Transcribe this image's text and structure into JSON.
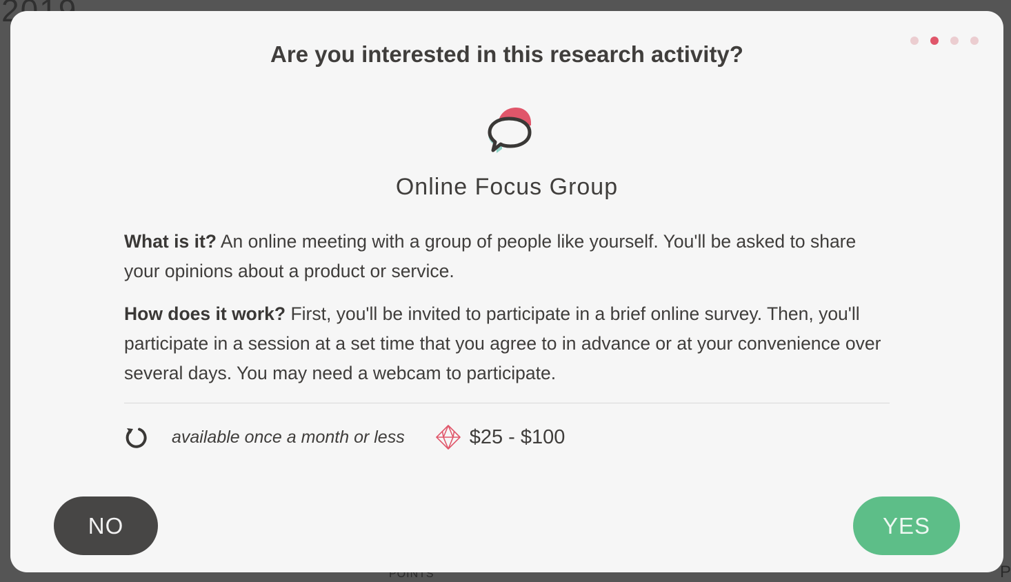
{
  "background": {
    "year_fragment": "2019",
    "points_label": "POINTS",
    "edge_letter": "P"
  },
  "modal": {
    "title": "Are you interested in this research activity?",
    "progress": {
      "total_steps": 4,
      "current_step": 2
    },
    "activity": {
      "icon": "chat-bubble-icon",
      "name": "Online Focus Group"
    },
    "description": {
      "what_label": "What is it?",
      "what_text": " An online meeting with a group of people like yourself. You'll be asked to share your opinions about a product or service.",
      "how_label": "How does it work?",
      "how_text": " First, you'll be invited to participate in a brief online survey. Then, you'll participate in a session at a set time that you agree to in advance or at your convenience over several days. You may need a webcam to participate."
    },
    "meta": {
      "frequency_icon": "refresh-icon",
      "frequency": "available once a month or less",
      "reward_icon": "gem-icon",
      "reward": "$25 - $100"
    },
    "buttons": {
      "no_label": "NO",
      "yes_label": "YES"
    }
  },
  "colors": {
    "accent_red": "#e0566a",
    "accent_teal": "#8fd3c7",
    "yes_green": "#5dbe88",
    "no_dark": "#474645",
    "modal_bg": "#f6f6f6",
    "overlay_bg": "#555555"
  }
}
